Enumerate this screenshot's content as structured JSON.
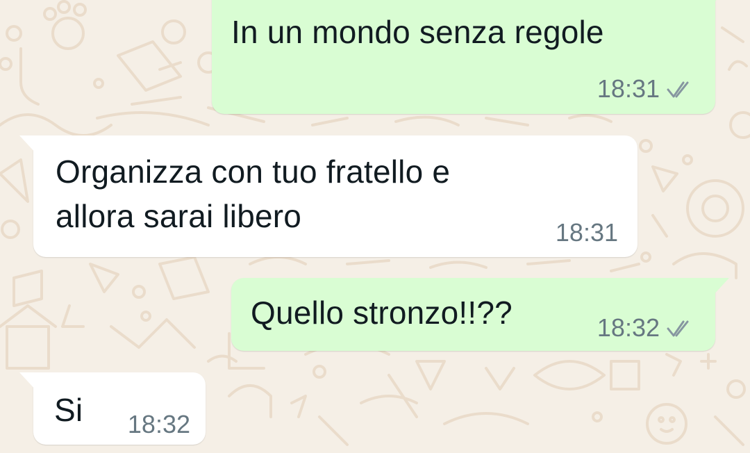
{
  "theme": {
    "background": "#f5efe6",
    "doodle_color": "#eadccb",
    "outgoing_bubble": "#d9fdd3",
    "incoming_bubble": "#ffffff",
    "text_color": "#111b21",
    "time_color": "#667781",
    "tick_color": "#8696a0"
  },
  "messages": [
    {
      "direction": "outgoing",
      "text_lines": [
        "In un mondo senza regole"
      ],
      "time": "18:31",
      "status_icon": "double-check-icon"
    },
    {
      "direction": "incoming",
      "text_lines": [
        "Organizza con tuo fratello e",
        "allora sarai libero"
      ],
      "time": "18:31"
    },
    {
      "direction": "outgoing",
      "text_lines": [
        "Quello stronzo!!??"
      ],
      "time": "18:32",
      "status_icon": "double-check-icon"
    },
    {
      "direction": "incoming",
      "text_lines": [
        "Si"
      ],
      "time": "18:32"
    }
  ]
}
